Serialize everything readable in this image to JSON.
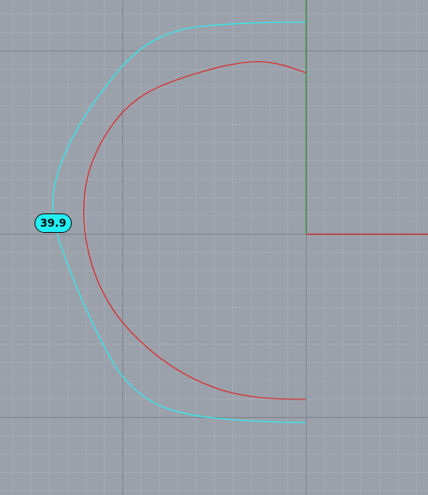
{
  "viewport": {
    "background": "#9aa1aa",
    "grid_minor_color": "#a7adb5",
    "grid_major_color": "#7f868f"
  },
  "axes": {
    "x_axis_color": "#c0282a",
    "y_axis_color": "#2f8a2f"
  },
  "curves": {
    "outer_curve_color": "#38e6ec",
    "inner_curve_color": "#e02222"
  },
  "dimension": {
    "label": "39.9",
    "label_color": "#22f0f5"
  }
}
